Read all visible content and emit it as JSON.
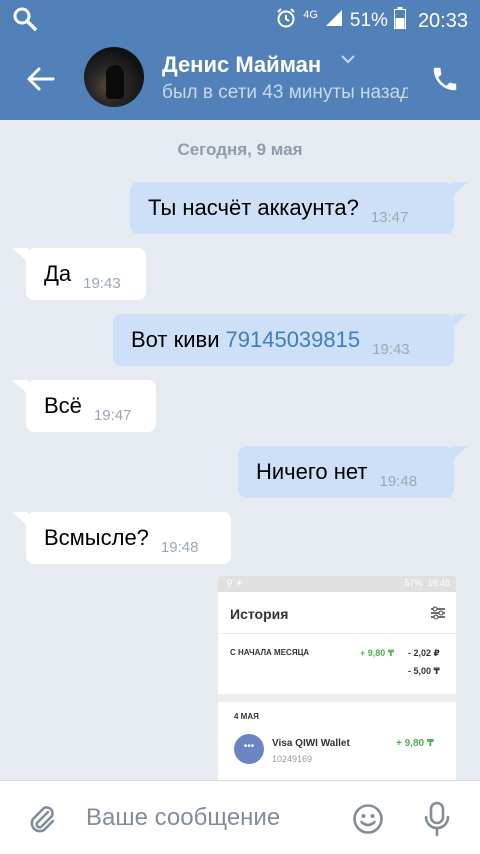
{
  "status_bar": {
    "network": "4G",
    "battery": "51%",
    "time": "20:33"
  },
  "header": {
    "contact_name": "Денис Майман",
    "last_seen": "был в сети 43 минуты назад"
  },
  "chat": {
    "date_separator": "Сегодня, 9 мая",
    "messages": [
      {
        "direction": "out",
        "text": "Ты насчёт аккаунта?",
        "time": "13:47"
      },
      {
        "direction": "in",
        "text": "Да",
        "time": "19:43"
      },
      {
        "direction": "out",
        "text": "Вот киви",
        "link": "79145039815",
        "time": "19:43"
      },
      {
        "direction": "in",
        "text": "Всё",
        "time": "19:47"
      },
      {
        "direction": "out",
        "text": "Ничего нет",
        "time": "19:48"
      },
      {
        "direction": "in",
        "text": "Всмысле?",
        "time": "19:48"
      }
    ]
  },
  "attachment": {
    "status_battery": "57%",
    "status_time": "19:48",
    "title": "История",
    "period_label": "С НАЧАЛА МЕСЯЦА",
    "income": "+ 9,80 ₸",
    "expense_rub": "- 2,02 ₽",
    "expense_tenge": "- 5,00 ₸",
    "date_label": "4 МАЯ",
    "item_name": "Visa QIWI Wallet",
    "item_number": "10249169",
    "item_amount": "+ 9,80 ₸"
  },
  "composer": {
    "placeholder": "Ваше сообщение"
  },
  "colors": {
    "header_bg": "#5181b8",
    "outgoing_bubble": "#cde0f7",
    "incoming_bubble": "#ffffff",
    "chat_bg": "#e6ebf2",
    "link": "#3f7dc1"
  },
  "icons": [
    "search-icon",
    "alarm-icon",
    "signal-icon",
    "battery-icon",
    "back-arrow-icon",
    "chevron-down-icon",
    "phone-icon",
    "paperclip-icon",
    "emoji-icon",
    "microphone-icon"
  ]
}
